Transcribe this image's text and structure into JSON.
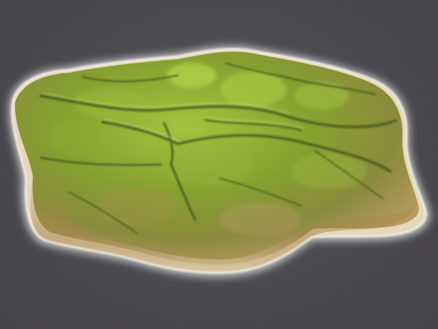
{
  "scene": {
    "background_color": "#4b4a4f",
    "subject": "island-terrain",
    "colors": {
      "grass_light": "#9fba3a",
      "grass_mid": "#7f9a2c",
      "grass_dark": "#4f6a1e",
      "soil": "#a9834f",
      "sand": "#e6dcc0",
      "foam": "#f4f3ef"
    }
  }
}
